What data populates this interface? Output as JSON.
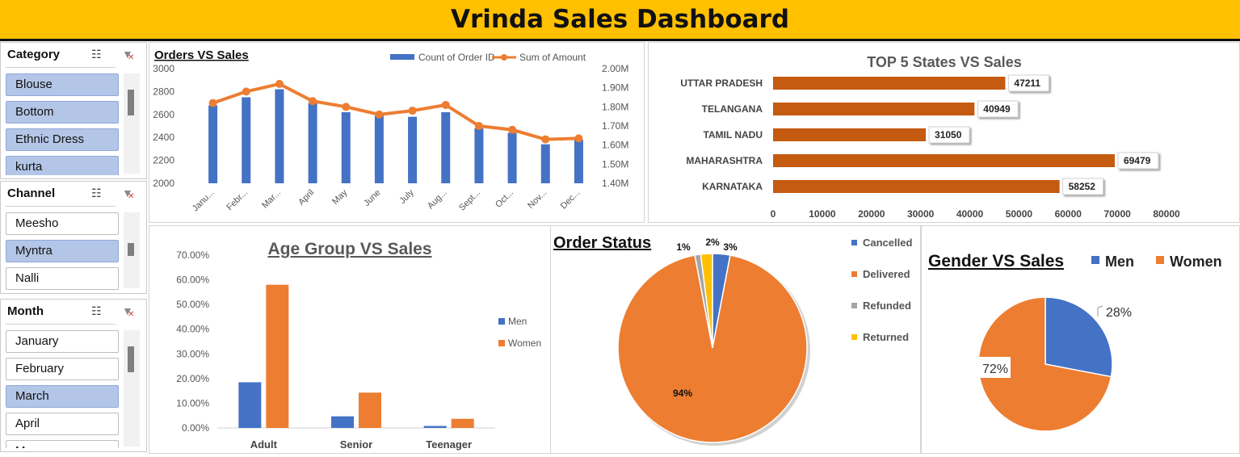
{
  "header": {
    "title": "Vrinda Sales Dashboard"
  },
  "slicers": {
    "category": {
      "title": "Category",
      "items": [
        {
          "label": "Blouse",
          "selected": true
        },
        {
          "label": "Bottom",
          "selected": true
        },
        {
          "label": "Ethnic Dress",
          "selected": true
        },
        {
          "label": "kurta",
          "selected": true
        }
      ]
    },
    "channel": {
      "title": "Channel",
      "items": [
        {
          "label": "Meesho",
          "selected": false
        },
        {
          "label": "Myntra",
          "selected": true
        },
        {
          "label": "Nalli",
          "selected": false
        }
      ]
    },
    "month": {
      "title": "Month",
      "items": [
        {
          "label": "January",
          "selected": false
        },
        {
          "label": "February",
          "selected": false
        },
        {
          "label": "March",
          "selected": true
        },
        {
          "label": "April",
          "selected": false
        },
        {
          "label": "May",
          "selected": false
        }
      ]
    }
  },
  "colors": {
    "blue": "#4472c4",
    "orange": "#ed7d31",
    "bar": "#c55a11",
    "gray": "#a5a5a5",
    "gold": "#ffc000",
    "header": "#ffc000"
  },
  "chart_data": [
    {
      "type": "bar+line",
      "title": "Orders VS Sales",
      "categories": [
        "January",
        "February",
        "March",
        "April",
        "May",
        "June",
        "July",
        "August",
        "September",
        "October",
        "November",
        "December"
      ],
      "tick_labels": [
        "Janu...",
        "Febr...",
        "Mar...",
        "April",
        "May",
        "June",
        "July",
        "Aug...",
        "Sept...",
        "Oct...",
        "Nov...",
        "Dec..."
      ],
      "series": [
        {
          "name": "Count of Order ID",
          "type": "bar",
          "axis": "left",
          "values": [
            2680,
            2750,
            2820,
            2700,
            2620,
            2590,
            2580,
            2620,
            2480,
            2440,
            2340,
            2380
          ]
        },
        {
          "name": "Sum of Amount",
          "type": "line",
          "axis": "right",
          "values": [
            1820000,
            1880000,
            1920000,
            1830000,
            1800000,
            1760000,
            1780000,
            1810000,
            1700000,
            1680000,
            1630000,
            1635000
          ]
        }
      ],
      "ylim": [
        2000,
        3000
      ],
      "yticks": [
        "2000",
        "2200",
        "2400",
        "2600",
        "2800",
        "3000"
      ],
      "y2lim": [
        1400000,
        2000000
      ],
      "y2ticks": [
        "1.40M",
        "1.50M",
        "1.60M",
        "1.70M",
        "1.80M",
        "1.90M",
        "2.00M"
      ],
      "legend": "top-right"
    },
    {
      "type": "bar",
      "orientation": "horizontal",
      "title": "TOP 5 States  VS Sales",
      "categories": [
        "UTTAR PRADESH",
        "TELANGANA",
        "TAMIL NADU",
        "MAHARASHTRA",
        "KARNATAKA"
      ],
      "values": [
        47211,
        40949,
        31050,
        69479,
        58252
      ],
      "xlim": [
        0,
        80000
      ],
      "xticks": [
        "0",
        "10000",
        "20000",
        "30000",
        "40000",
        "50000",
        "60000",
        "70000",
        "80000"
      ],
      "data_labels": true
    },
    {
      "type": "bar",
      "title": "Age Group VS Sales",
      "categories": [
        "Adult",
        "Senior",
        "Teenager"
      ],
      "series": [
        {
          "name": "Men",
          "values": [
            0.185,
            0.047,
            0.008
          ]
        },
        {
          "name": "Women",
          "values": [
            0.58,
            0.143,
            0.037
          ]
        }
      ],
      "ylim": [
        0,
        0.7
      ],
      "yticks": [
        "0.00%",
        "10.00%",
        "20.00%",
        "30.00%",
        "40.00%",
        "50.00%",
        "60.00%",
        "70.00%"
      ],
      "legend": "right"
    },
    {
      "type": "pie",
      "title": "Order Status",
      "labels": [
        "Cancelled",
        "Delivered",
        "Refunded",
        "Returned"
      ],
      "values": [
        3,
        94,
        1,
        2
      ],
      "value_labels": [
        "3%",
        "94%",
        "1%",
        "2%"
      ],
      "legend": "right"
    },
    {
      "type": "pie",
      "title": "Gender VS Sales",
      "labels": [
        "Men",
        "Women"
      ],
      "values": [
        28,
        72
      ],
      "value_labels": [
        "28%",
        "72%"
      ],
      "legend": "top"
    }
  ]
}
